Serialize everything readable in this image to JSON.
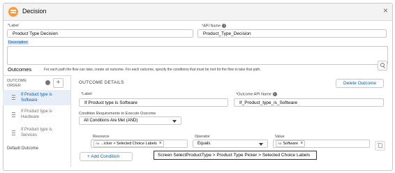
{
  "header": {
    "title": "Decision",
    "close_glyph": "×"
  },
  "label_field": {
    "label": "Label",
    "required_mark": "*",
    "value": "Product Type Decision"
  },
  "api_name_field": {
    "label": "API Name",
    "required_mark": "*",
    "value": "Product_Type_Decision",
    "info_glyph": "i"
  },
  "description_field": {
    "label": "Description",
    "value": ""
  },
  "outcomes": {
    "title": "Outcomes",
    "help_text": "For each path the flow can take, create an outcome. For each outcome, specify the conditions that must be met for the flow to take that path."
  },
  "sidebar": {
    "order_label_1": "OUTCOME",
    "order_label_2": "ORDER",
    "add_glyph": "+",
    "items": [
      {
        "line1": "If Product type is",
        "line2": "Software",
        "active": true
      },
      {
        "line1": "If Product type is",
        "line2": "Hardware",
        "active": false
      },
      {
        "line1": "If Product type is",
        "line2": "Services",
        "active": false
      }
    ],
    "default_outcome": "Default Outcome"
  },
  "details": {
    "title": "OUTCOME DETAILS",
    "delete_button": "Delete Outcome",
    "label": {
      "label": "Label",
      "required_mark": "*",
      "value": "If Product type is Software"
    },
    "api_name": {
      "label": "Outcome API Name",
      "required_mark": "*",
      "value": "If_Product_type_is_Software",
      "info_glyph": "i"
    },
    "condition_req": {
      "label": "Condition Requirements to Execute Outcome",
      "value": "All Conditions Are Met (AND)"
    },
    "condition_row": {
      "resource_label": "Resource",
      "resource_icon": "Aa",
      "resource_value": "...icker > Selected Choice Labels",
      "operator_label": "Operator",
      "operator_value": "Equals",
      "value_label": "Value",
      "value_icon": "Aa",
      "value_value": "Software",
      "remove_glyph": "×"
    },
    "add_condition": "+ Add Condition",
    "tooltip": "Screen SelectProductType > Product Type Picker > Selected Choice Labels"
  },
  "colors": {
    "accent": "#0b5cab",
    "header_icon": "#ff9a3c",
    "active_item_bg": "#e8eef7"
  }
}
